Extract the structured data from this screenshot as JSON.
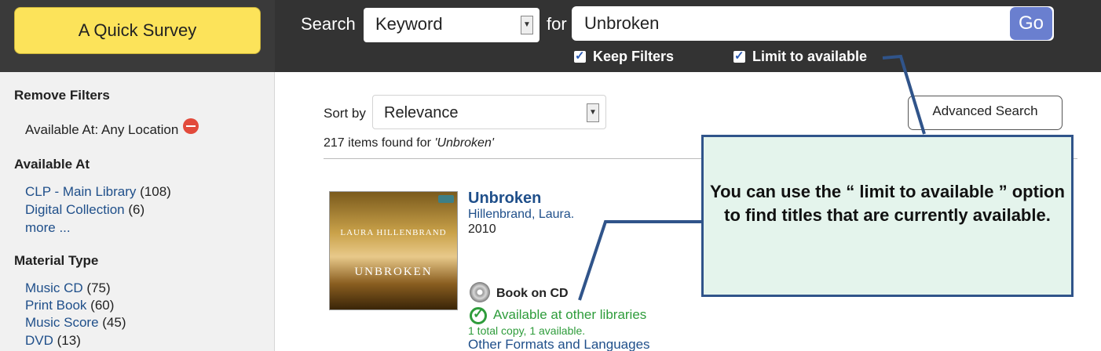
{
  "header": {
    "survey_label": "A Quick Survey",
    "search_label": "Search",
    "search_type": "Keyword",
    "for_label": "for",
    "search_value": "Unbroken",
    "go_label": "Go",
    "keep_filters_label": "Keep Filters",
    "limit_available_label": "Limit to available"
  },
  "sidebar": {
    "remove_filters_heading": "Remove Filters",
    "active_filter": "Available At: Any Location",
    "available_at_heading": "Available At",
    "available_at": [
      {
        "label": "CLP - Main Library",
        "count": "(108)"
      },
      {
        "label": "Digital Collection",
        "count": "(6)"
      }
    ],
    "more_label": "more ...",
    "material_type_heading": "Material Type",
    "material_types": [
      {
        "label": "Music CD",
        "count": "(75)"
      },
      {
        "label": "Print Book",
        "count": "(60)"
      },
      {
        "label": "Music Score",
        "count": "(45)"
      },
      {
        "label": "DVD",
        "count": "(13)"
      }
    ]
  },
  "main": {
    "sort_label": "Sort by",
    "sort_value": "Relevance",
    "advanced_search_label": "Advanced Search",
    "results_count": "217 items found for",
    "results_query": "'Unbroken'",
    "result": {
      "title": "Unbroken",
      "author": "Hillenbrand, Laura.",
      "year": "2010",
      "cover_author": "LAURA HILLENBRAND",
      "cover_title": "UNBROKEN",
      "format": "Book on CD",
      "availability": "Available at other libraries",
      "copies": "1 total copy, 1 available.",
      "other_formats": "Other Formats and Languages"
    }
  },
  "callout": {
    "text": "You can use the “ limit to available ” option to find titles that are currently available."
  },
  "colors": {
    "topbar": "#333333",
    "survey_button": "#fce35a",
    "go_button": "#6a7fcf",
    "link": "#1f4f8a",
    "available": "#2e9c3b",
    "callout_bg": "#e4f4ec",
    "callout_border": "#30548a"
  }
}
